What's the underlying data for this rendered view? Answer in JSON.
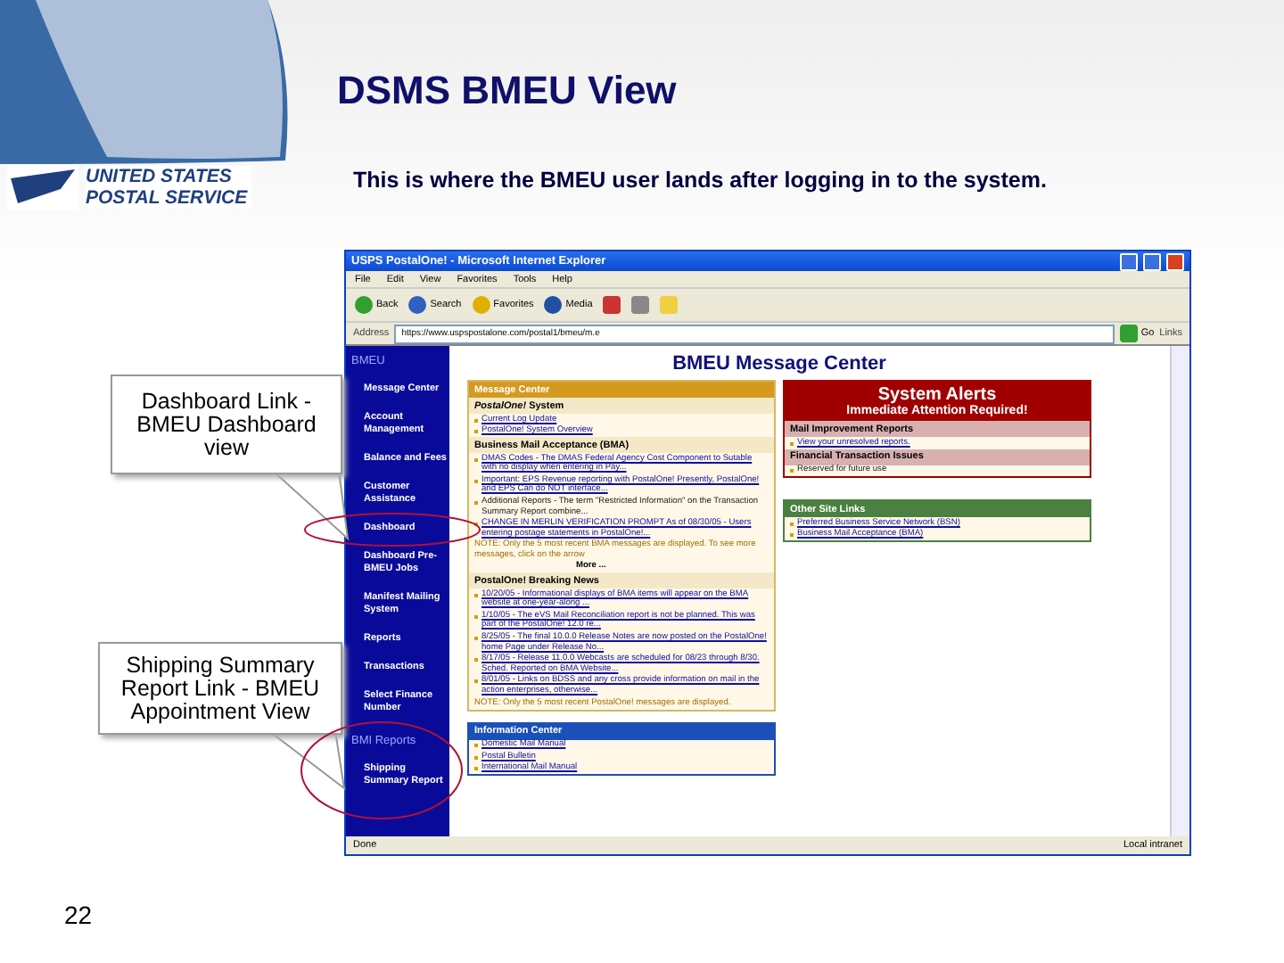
{
  "slide": {
    "title": "DSMS BMEU View",
    "subtitle": "This is where the BMEU user lands after logging in to the system.",
    "logo": [
      "UNITED STATES",
      "POSTAL SERVICE"
    ],
    "page_number": "22"
  },
  "callouts": [
    {
      "text": "Dashboard Link - BMEU Dashboard view",
      "kind": "dashboard"
    },
    {
      "text": "Shipping Summary Report Link - BMEU Appointment View",
      "kind": "shipping"
    }
  ],
  "browser": {
    "title": "USPS PostalOne! - Microsoft Internet Explorer",
    "menu": [
      "File",
      "Edit",
      "View",
      "Favorites",
      "Tools",
      "Help"
    ],
    "toolbar": [
      "Back",
      "Search",
      "Favorites",
      "Media"
    ],
    "address": {
      "label": "Address",
      "value": "https://www.uspspostalone.com/postal1/bmeu/m.e",
      "go": "Go",
      "links": "Links"
    },
    "status": {
      "left": "Done",
      "right": "Local intranet"
    }
  },
  "sidebar": [
    {
      "kind": "section",
      "label": "BMEU"
    },
    {
      "kind": "link",
      "label": "Message Center"
    },
    {
      "kind": "link",
      "label": "Account Management"
    },
    {
      "kind": "link",
      "label": "Balance and Fees"
    },
    {
      "kind": "link",
      "label": "Customer Assistance"
    },
    {
      "kind": "link",
      "label": "Dashboard"
    },
    {
      "kind": "link",
      "label": "Dashboard Pre-BMEU Jobs"
    },
    {
      "kind": "link",
      "label": "Manifest Mailing System"
    },
    {
      "kind": "link",
      "label": "Reports"
    },
    {
      "kind": "link",
      "label": "Transactions"
    },
    {
      "kind": "link",
      "label": "Select Finance Number"
    },
    {
      "kind": "section",
      "label": "BMI Reports"
    },
    {
      "kind": "link",
      "label": "Shipping Summary Report"
    }
  ],
  "page_heading": "BMEU Message Center",
  "message_center": {
    "header": "Message Center",
    "sections": [
      {
        "heading": "*PostalOne!* System",
        "items": [
          {
            "kind": "link",
            "text": "Current Log Update"
          },
          {
            "kind": "link",
            "text": "PostalOne! System Overview"
          }
        ]
      },
      {
        "heading": "Business Mail Acceptance (BMA)",
        "items": [
          {
            "kind": "link",
            "text": "DMAS Codes - The DMAS Federal Agency Cost Component to Sutable with no display when entering in Pay..."
          },
          {
            "kind": "link",
            "text": "Important: EPS Revenue reporting with PostalOne! Presently, PostalOne! and EPS Can do NOT interface..."
          },
          {
            "kind": "plain",
            "text": "Additional Reports - The term \"Restricted Information\" on the Transaction Summary Report combine..."
          },
          {
            "kind": "link",
            "text": "CHANGE IN MERLIN VERIFICATION PROMPT As of 08/30/05 - Users entering postage statements in PostalOne!..."
          },
          {
            "kind": "note",
            "text": "NOTE: Only the 5 most recent BMA messages are displayed. To see more messages, click on the arrow"
          },
          {
            "kind": "more",
            "text": "More ..."
          }
        ]
      },
      {
        "heading": "PostalOne! Breaking News",
        "items": [
          {
            "kind": "link",
            "text": "10/20/05 - Informational displays of BMA items will appear on the BMA website at one-year-along ..."
          },
          {
            "kind": "link",
            "text": "1/10/05 - The eVS Mail Reconciliation report is not be planned. This was part of the PostalOne! 12.0 re..."
          },
          {
            "kind": "link",
            "text": "8/25/05 - The final 10.0.0 Release Notes are now posted on the PostalOne! home Page under Release No..."
          },
          {
            "kind": "link",
            "text": "8/17/05 - Release 11.0.0 Webcasts are scheduled for 08/23 through 8/30. Sched. Reported on BMA Website..."
          },
          {
            "kind": "link",
            "text": "8/01/05 - Links on BDSS and any cross provide information on mail in the action enterprises, otherwise..."
          },
          {
            "kind": "note",
            "text": "NOTE: Only the 5 most recent PostalOne! messages are displayed."
          }
        ]
      }
    ]
  },
  "information_center": {
    "header": "Information Center",
    "items": [
      "Domestic Mail Manual",
      "Postal Bulletin",
      "International Mail Manual"
    ]
  },
  "system_alerts": {
    "title": "System Alerts",
    "subtitle": "Immediate Attention Required!",
    "sections": [
      {
        "heading": "Mail Improvement Reports",
        "items": [
          {
            "kind": "link",
            "text": "View your unresolved reports."
          }
        ]
      },
      {
        "heading": "Financial Transaction Issues",
        "items": [
          {
            "kind": "plain",
            "text": "Reserved for future use"
          }
        ]
      }
    ]
  },
  "other_links": {
    "header": "Other Site Links",
    "items": [
      "Preferred Business Service Network (BSN)",
      "Business Mail Acceptance (BMA)"
    ]
  }
}
